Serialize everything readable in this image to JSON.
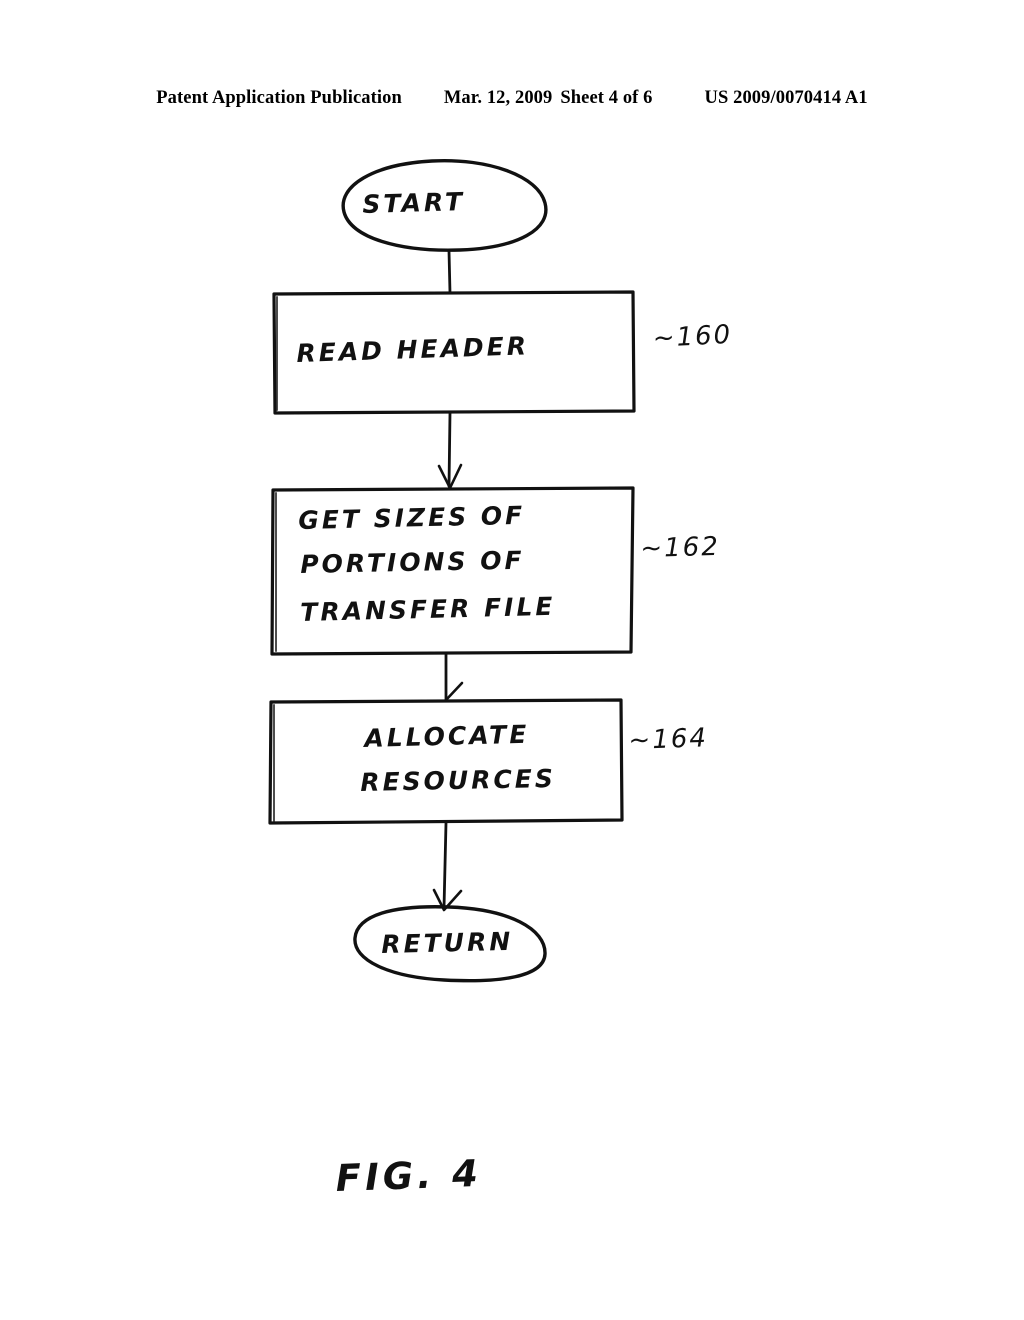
{
  "header": {
    "publication": "Patent Application Publication",
    "date": "Mar. 12, 2009",
    "sheet": "Sheet 4 of 6",
    "patent_number": "US 2009/0070414 A1"
  },
  "figure": {
    "caption": "FIG. 4",
    "ink_color": "#111111",
    "paper_color": "#ffffff"
  },
  "chart_data": {
    "type": "diagram",
    "title": "FIG. 4",
    "diagram_kind": "flowchart",
    "orientation": "top-to-bottom",
    "nodes": [
      {
        "id": "start",
        "shape": "oval",
        "label": "START",
        "ref": ""
      },
      {
        "id": "n160",
        "shape": "rectangle",
        "label": "READ HEADER",
        "ref": "~160"
      },
      {
        "id": "n162",
        "shape": "rectangle",
        "label": "GET SIZES OF PORTIONS OF TRANSFER FILE",
        "ref": "~162"
      },
      {
        "id": "n164",
        "shape": "rectangle",
        "label": "ALLOCATE RESOURCES",
        "ref": "~164"
      },
      {
        "id": "return",
        "shape": "oval",
        "label": "RETURN",
        "ref": ""
      }
    ],
    "edges": [
      {
        "from": "start",
        "to": "n160",
        "arrowhead": false
      },
      {
        "from": "n160",
        "to": "n162",
        "arrowhead": true
      },
      {
        "from": "n162",
        "to": "n164",
        "arrowhead": true
      },
      {
        "from": "n164",
        "to": "return",
        "arrowhead": true
      }
    ]
  },
  "nodes": {
    "start": {
      "label": "START"
    },
    "read_header": {
      "label": "READ HEADER",
      "ref": "~160"
    },
    "get_sizes": {
      "line1": "GET SIZES OF",
      "line2": "PORTIONS OF",
      "line3": "TRANSFER FILE",
      "ref": "~162"
    },
    "allocate": {
      "line1": "ALLOCATE",
      "line2": "RESOURCES",
      "ref": "~164"
    },
    "return": {
      "label": "RETURN"
    }
  }
}
